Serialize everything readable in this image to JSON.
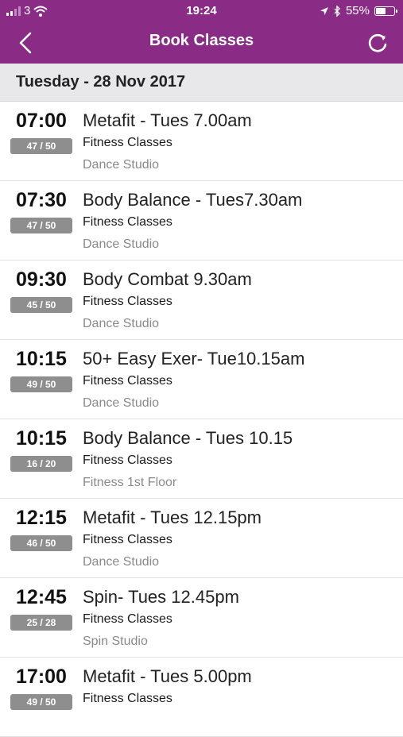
{
  "status_bar": {
    "carrier": "3",
    "time": "19:24",
    "battery": "55%",
    "battery_level": 0.55,
    "icons": [
      "signal-bars",
      "wifi",
      "location-arrow",
      "bluetooth",
      "battery"
    ]
  },
  "nav": {
    "title": "Book Classes",
    "back_icon": "chevron-left",
    "refresh_icon": "refresh"
  },
  "colors": {
    "header_bg": "#8a2c86",
    "badge_bg": "#8e8e8e"
  },
  "date_header": "Tuesday - 28 Nov 2017",
  "classes": [
    {
      "time": "07:00",
      "spaces": "47 / 50",
      "name": "Metafit - Tues 7.00am",
      "category": "Fitness Classes",
      "location": "Dance Studio"
    },
    {
      "time": "07:30",
      "spaces": "47 / 50",
      "name": "Body Balance - Tues7.30am",
      "category": "Fitness Classes",
      "location": "Dance Studio"
    },
    {
      "time": "09:30",
      "spaces": "45 / 50",
      "name": "Body Combat 9.30am",
      "category": "Fitness Classes",
      "location": "Dance Studio"
    },
    {
      "time": "10:15",
      "spaces": "49 / 50",
      "name": "50+ Easy Exer- Tue10.15am",
      "category": "Fitness Classes",
      "location": "Dance Studio"
    },
    {
      "time": "10:15",
      "spaces": "16 / 20",
      "name": "Body Balance - Tues 10.15",
      "category": "Fitness Classes",
      "location": "Fitness 1st Floor"
    },
    {
      "time": "12:15",
      "spaces": "46 / 50",
      "name": "Metafit - Tues 12.15pm",
      "category": "Fitness Classes",
      "location": "Dance Studio"
    },
    {
      "time": "12:45",
      "spaces": "25 / 28",
      "name": "Spin- Tues 12.45pm",
      "category": "Fitness Classes",
      "location": "Spin Studio"
    },
    {
      "time": "17:00",
      "spaces": "49 / 50",
      "name": "Metafit - Tues 5.00pm",
      "category": "Fitness Classes",
      "location": ""
    }
  ]
}
